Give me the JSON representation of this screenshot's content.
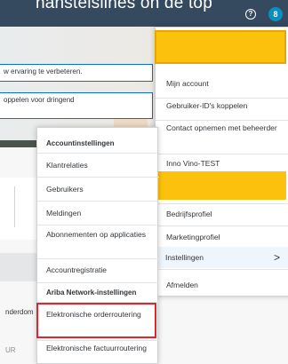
{
  "topbar": {
    "text": "nanstelslines on de top",
    "help_icon": "?",
    "avatar_initial": "8"
  },
  "background": {
    "notices": [
      "w ervaring te verbeteren.",
      "oppelen voor dringend"
    ],
    "edge_texts": [
      "nderdom",
      "UR"
    ]
  },
  "user_menu": {
    "items": [
      "Mijn account",
      "Gebruiker-ID's koppelen",
      "Contact opnemen met beheerder",
      "Inno Vino-TEST",
      "Bedrijfsprofiel",
      "Marketingprofiel",
      "Instellingen",
      "Afmelden"
    ],
    "chevron": ">"
  },
  "settings_menu": {
    "account_header": "Accountinstellingen",
    "account_items": [
      "Klantrelaties",
      "Gebruikers",
      "Meldingen",
      "Abonnementen op applicaties",
      "Accountregistratie"
    ],
    "network_header": "Ariba Network-instellingen",
    "network_items": [
      "Elektronische orderroutering",
      "Elektronische factuurroutering"
    ]
  },
  "colors": {
    "shell": "#354a5f",
    "highlight_yellow": "#fbc10c",
    "highlight_red": "#e3242b",
    "accent_blue": "#0a6ed1"
  }
}
